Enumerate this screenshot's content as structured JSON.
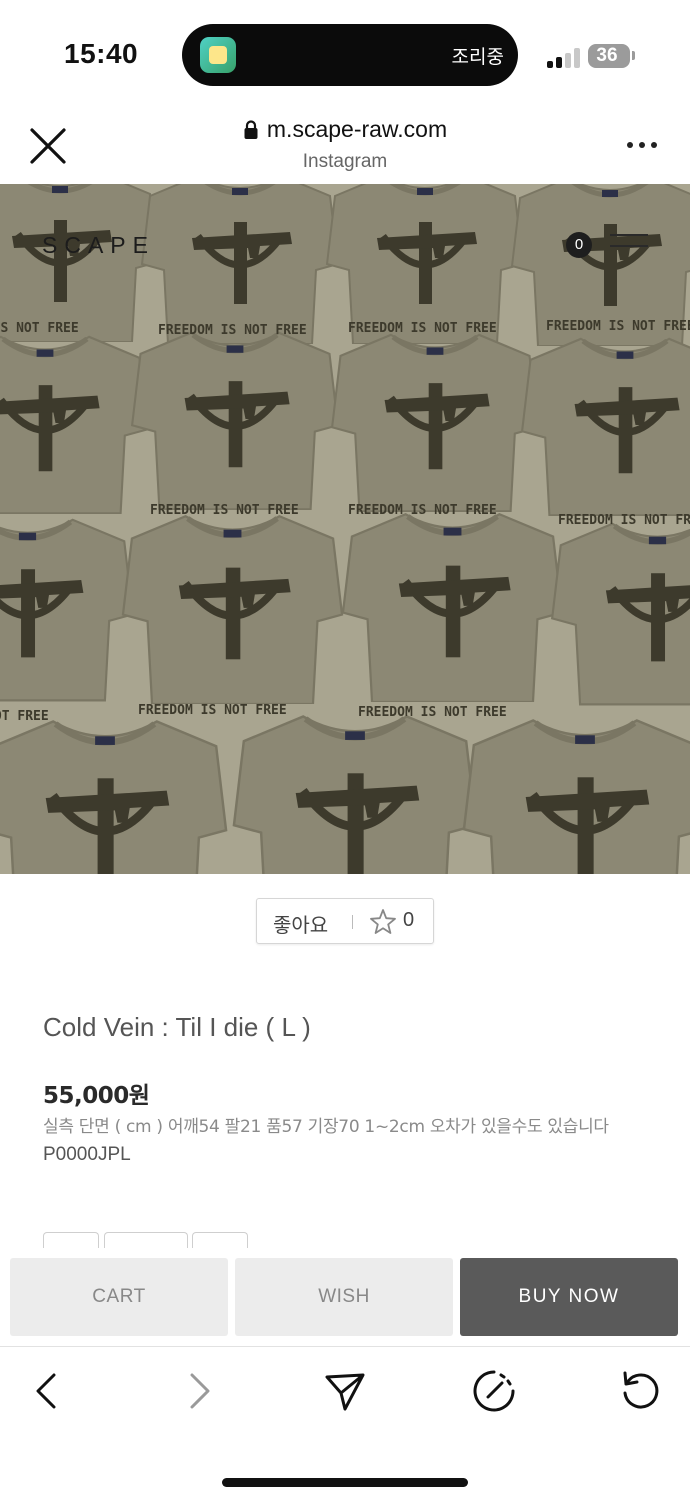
{
  "status_bar": {
    "time": "15:40",
    "activity_text": "조리중",
    "battery": "36",
    "icons": [
      "app-icon",
      "signal-icon",
      "battery-icon"
    ]
  },
  "browser": {
    "url": "m.scape-raw.com",
    "source": "Instagram",
    "icons": [
      "close-icon",
      "lock-icon",
      "more-icon"
    ]
  },
  "hero": {
    "brand": "SCAPE",
    "cart_count": "0",
    "print_text": "FREEDOM IS NOT FREE",
    "shirt_color": "#8a8672"
  },
  "like": {
    "label": "좋아요",
    "count": "0"
  },
  "product": {
    "name": "Cold Vein : Til I die ( L )",
    "price": "55,000원",
    "description": "실측 단면 ( cm ) 어깨54 팔21 품57 기장70 1~2cm 오차가 있을수도 있습니다",
    "code": "P0000JPL"
  },
  "actions": {
    "cart": "CART",
    "wish": "WISH",
    "buy_now": "BUY NOW"
  },
  "toolbar": {
    "icons": [
      "back-icon",
      "forward-icon",
      "share-icon",
      "compass-icon",
      "reload-icon"
    ]
  },
  "colors": {
    "accent_button": "#5a5a5a",
    "secondary_button": "#ececec",
    "background": "#ffffff"
  }
}
